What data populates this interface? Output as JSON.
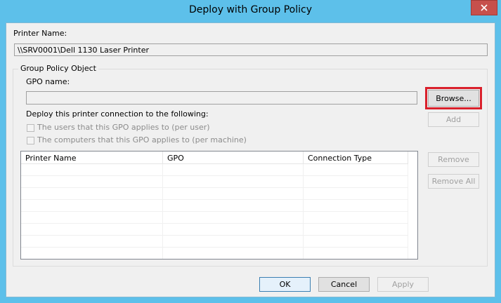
{
  "window": {
    "title": "Deploy with Group Policy",
    "close_icon": "close-icon"
  },
  "printer": {
    "label": "Printer Name:",
    "value": "\\\\SRV0001\\Dell 1130 Laser Printer"
  },
  "gpo_group": {
    "title": "Group Policy Object",
    "gpo_name_label": "GPO name:",
    "gpo_name_value": "",
    "browse_label": "Browse...",
    "add_label": "Add",
    "deploy_label": "Deploy this printer connection to the following:",
    "per_user_label": "The users that this GPO applies to (per user)",
    "per_user_checked": false,
    "per_machine_label": "The computers that this GPO applies to (per machine)",
    "per_machine_checked": false
  },
  "list": {
    "columns": [
      "Printer Name",
      "GPO",
      "Connection Type"
    ],
    "rows": [],
    "remove_label": "Remove",
    "remove_all_label": "Remove All"
  },
  "footer": {
    "ok_label": "OK",
    "cancel_label": "Cancel",
    "apply_label": "Apply"
  },
  "colors": {
    "titlebar": "#5dc0ea",
    "close": "#c7504c",
    "highlight": "#d9202b"
  }
}
